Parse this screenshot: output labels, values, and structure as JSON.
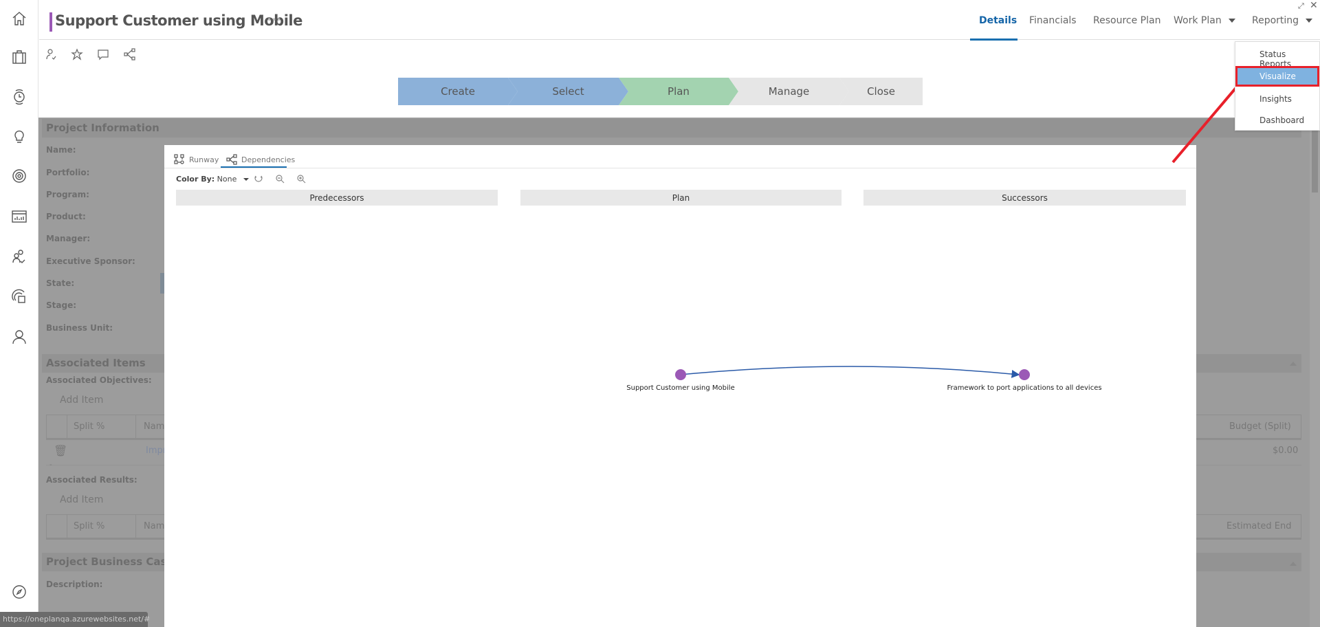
{
  "header": {
    "title": "Support Customer using Mobile",
    "more": "•••",
    "tabs": [
      {
        "label": "Details",
        "active": true
      },
      {
        "label": "Financials"
      },
      {
        "label": "Resource Plan"
      },
      {
        "label": "Work Plan",
        "dropdown": true
      },
      {
        "label": "Reporting",
        "dropdown": true
      }
    ]
  },
  "window_icons": [
    "expand-icon",
    "close-icon"
  ],
  "sidebar": {
    "icons": [
      "home-icon",
      "briefcase-icon",
      "timesheet-icon",
      "lightbulb-icon",
      "target-icon",
      "chart-icon",
      "team-icon",
      "report-icon",
      "user-icon",
      "compass-icon"
    ]
  },
  "toolbar": {
    "icons": [
      "assign-user-icon",
      "star-icon",
      "comment-icon",
      "share-icon"
    ]
  },
  "stages": [
    {
      "label": "Create",
      "color": "#8cb1d9"
    },
    {
      "label": "Select",
      "color": "#8cb1d9"
    },
    {
      "label": "Plan",
      "color": "#a3d3b0"
    },
    {
      "label": "Manage",
      "color": "#e6e6e6"
    },
    {
      "label": "Close",
      "color": "#e6e6e6"
    }
  ],
  "background": {
    "project_info": {
      "title": "Project Information",
      "labels": [
        "Name:",
        "Portfolio:",
        "Program:",
        "Product:",
        "Manager:",
        "Executive Sponsor:",
        "State:",
        "Stage:",
        "Business Unit:"
      ]
    },
    "associated": {
      "title": "Associated Items",
      "objectives_label": "Associated Objectives:",
      "add_item": "Add Item",
      "split": "Split %",
      "name": "Name",
      "row_name": "Impr",
      "budget": "Budget (Split)",
      "budget_value": "$0.00",
      "dash": "-",
      "results_label": "Associated Results:",
      "estimated_end": "Estimated End"
    },
    "business_case": {
      "title": "Project Business Case",
      "description_label": "Description:"
    }
  },
  "modal": {
    "tabs": [
      {
        "label": "Runway"
      },
      {
        "label": "Dependencies",
        "active": true
      }
    ],
    "color_by_label": "Color By:",
    "color_by_value": "None",
    "columns": [
      "Predecessors",
      "Plan",
      "Successors"
    ],
    "nodes": [
      {
        "label": "Support Customer using Mobile",
        "color": "#9b59b6"
      },
      {
        "label": "Framework to port applications to all devices",
        "color": "#9b59b6"
      }
    ],
    "edge_color": "#2a5aa8"
  },
  "dropdown": {
    "items": [
      {
        "label": "Status Reports"
      },
      {
        "label": "Visualize",
        "selected": true
      },
      {
        "label": "Insights"
      },
      {
        "label": "Dashboard"
      }
    ]
  },
  "annotation_color": "#e8202a",
  "status_url": "https://oneplanqa.azurewebsites.net/#"
}
